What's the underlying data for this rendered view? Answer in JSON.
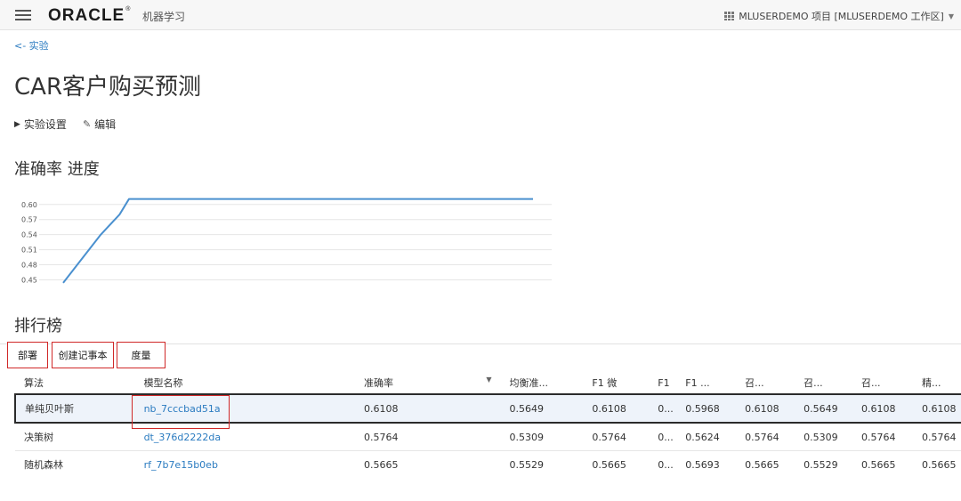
{
  "header": {
    "logo": "ORACLE",
    "logo_mark": "®",
    "product": "机器学习",
    "project": "MLUSERDEMO 项目 [MLUSERDEMO 工作区]"
  },
  "nav": {
    "back_label": "<- 实验"
  },
  "experiment": {
    "title": "CAR客户购买预测",
    "settings_label": "实验设置",
    "edit_label": "编辑"
  },
  "accuracy_section": {
    "title": "准确率 进度"
  },
  "chart_data": {
    "type": "line",
    "title": "",
    "xlabel": "",
    "ylabel": "",
    "yticks": [
      "0.60",
      "0.57",
      "0.54",
      "0.51",
      "0.48",
      "0.45"
    ],
    "ylim": [
      0.442,
      0.612
    ],
    "grid": true,
    "series": [
      {
        "x": [
          0,
          3,
          8,
          12,
          14,
          100
        ],
        "values": [
          0.444,
          0.48,
          0.54,
          0.58,
          0.6108,
          0.6108
        ]
      }
    ],
    "colors": {
      "line": "#4a90cf",
      "grid": "#e6e6e6"
    }
  },
  "leaderboard": {
    "title": "排行榜",
    "buttons": {
      "deploy": "部署",
      "create_notebook": "创建记事本",
      "metrics": "度量"
    },
    "columns": [
      "算法",
      "模型名称",
      "准确率",
      "均衡准...",
      "F1 微",
      "F1",
      "F1 ...",
      "召...",
      "召...",
      "召...",
      "精..."
    ],
    "rows": [
      {
        "algorithm": "单纯贝叶斯",
        "model": "nb_7cccbad51a",
        "values": [
          "0.6108",
          "0.5649",
          "0.6108",
          "0...",
          "0.5968",
          "0.6108",
          "0.5649",
          "0.6108",
          "0.6108"
        ]
      },
      {
        "algorithm": "决策树",
        "model": "dt_376d2222da",
        "values": [
          "0.5764",
          "0.5309",
          "0.5764",
          "0...",
          "0.5624",
          "0.5764",
          "0.5309",
          "0.5764",
          "0.5764"
        ]
      },
      {
        "algorithm": "随机森林",
        "model": "rf_7b7e15b0eb",
        "values": [
          "0.5665",
          "0.5529",
          "0.5665",
          "0...",
          "0.5693",
          "0.5665",
          "0.5529",
          "0.5665",
          "0.5665"
        ]
      }
    ]
  }
}
